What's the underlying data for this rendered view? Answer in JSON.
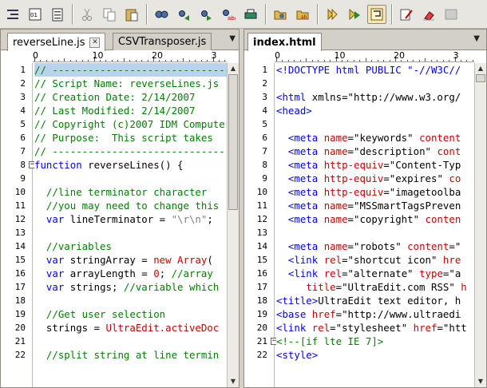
{
  "toolbar": {
    "buttons": [
      {
        "name": "indent-icon"
      },
      {
        "name": "hex-icon"
      },
      {
        "name": "clipboard-list-icon"
      },
      {
        "sep": true
      },
      {
        "name": "cut-icon"
      },
      {
        "name": "copy-icon"
      },
      {
        "name": "paste-icon"
      },
      {
        "sep": true
      },
      {
        "name": "find-icon"
      },
      {
        "name": "find-prev-icon"
      },
      {
        "name": "find-next-icon"
      },
      {
        "name": "replace-icon"
      },
      {
        "name": "print-icon"
      },
      {
        "sep": true
      },
      {
        "name": "folder-search-icon"
      },
      {
        "name": "folder-replace-icon"
      },
      {
        "sep": true
      },
      {
        "name": "macro-icon"
      },
      {
        "name": "play-macro-icon"
      },
      {
        "name": "wrap-icon",
        "active": true
      },
      {
        "sep": true
      },
      {
        "name": "edit-icon"
      },
      {
        "name": "erase-icon"
      },
      {
        "name": "column-icon"
      }
    ]
  },
  "left_pane": {
    "tabs": [
      {
        "label": "reverseLine.js",
        "active": true
      },
      {
        "label": "CSVTransposer.js",
        "active": false
      }
    ],
    "ruler": [
      "0",
      "10",
      "20",
      "3"
    ],
    "lines": [
      {
        "n": "1",
        "fold": false,
        "selected": true,
        "html": "<span class='c-comment'>// ---------------------------------------</span>"
      },
      {
        "n": "2",
        "fold": false,
        "html": "<span class='c-comment'>// Script Name: reverseLines.js</span>"
      },
      {
        "n": "3",
        "fold": false,
        "html": "<span class='c-comment'>// Creation Date: 2/14/2007</span>"
      },
      {
        "n": "4",
        "fold": false,
        "html": "<span class='c-comment'>// Last Modified: 2/14/2007</span>"
      },
      {
        "n": "5",
        "fold": false,
        "html": "<span class='c-comment'>// Copyright (c)2007 IDM Computer</span>"
      },
      {
        "n": "6",
        "fold": false,
        "html": "<span class='c-comment'>// Purpose:  This script takes</span>"
      },
      {
        "n": "7",
        "fold": false,
        "html": "<span class='c-comment'>// ---------------------------------------</span>"
      },
      {
        "n": "8",
        "fold": true,
        "html": "<span class='c-key'>function</span> reverseLines() {"
      },
      {
        "n": "9",
        "fold": false,
        "html": ""
      },
      {
        "n": "10",
        "fold": false,
        "html": "  <span class='c-comment'>//line terminator character</span>"
      },
      {
        "n": "11",
        "fold": false,
        "html": "  <span class='c-comment'>//you may need to change this</span>"
      },
      {
        "n": "12",
        "fold": false,
        "html": "  <span class='c-key'>var</span> lineTerminator = <span class='c-str'>\"\\r\\n\"</span>;"
      },
      {
        "n": "13",
        "fold": false,
        "html": ""
      },
      {
        "n": "14",
        "fold": false,
        "html": "  <span class='c-comment'>//variables</span>"
      },
      {
        "n": "15",
        "fold": false,
        "html": "  <span class='c-key'>var</span> stringArray = <span class='c-red'>new Array</span>("
      },
      {
        "n": "16",
        "fold": false,
        "html": "  <span class='c-key'>var</span> arrayLength = <span class='c-red'>0</span>; <span class='c-comment'>//array</span>"
      },
      {
        "n": "17",
        "fold": false,
        "html": "  <span class='c-key'>var</span> strings; <span class='c-comment'>//variable which</span>"
      },
      {
        "n": "18",
        "fold": false,
        "html": ""
      },
      {
        "n": "19",
        "fold": false,
        "html": "  <span class='c-comment'>//Get user selection</span>"
      },
      {
        "n": "20",
        "fold": false,
        "html": "  strings = <span class='c-red'>UltraEdit.activeDoc</span>"
      },
      {
        "n": "21",
        "fold": false,
        "html": ""
      },
      {
        "n": "22",
        "fold": false,
        "html": "  <span class='c-comment'>//split string at line termin</span>"
      }
    ]
  },
  "right_pane": {
    "tabs": [
      {
        "label": "index.html",
        "active": true
      }
    ],
    "ruler": [
      "0",
      "10",
      "20",
      "3"
    ],
    "lines": [
      {
        "n": "1",
        "fold": false,
        "html": "<span class='c-tag'>&lt;!DOCTYPE html PUBLIC \"-//W3C//</span>"
      },
      {
        "n": "2",
        "fold": false,
        "html": ""
      },
      {
        "n": "3",
        "fold": false,
        "html": "<span class='c-tag'>&lt;html</span> xmlns=\"http://www.w3.org/"
      },
      {
        "n": "4",
        "fold": false,
        "html": "<span class='c-tag'>&lt;head&gt;</span>"
      },
      {
        "n": "5",
        "fold": false,
        "html": ""
      },
      {
        "n": "6",
        "fold": false,
        "html": "  <span class='c-tag'>&lt;meta</span> <span class='c-attr'>name</span>=\"keywords\" <span class='c-attr'>content</span>"
      },
      {
        "n": "7",
        "fold": false,
        "html": "  <span class='c-tag'>&lt;meta</span> <span class='c-attr'>name</span>=\"description\" <span class='c-attr'>cont</span>"
      },
      {
        "n": "8",
        "fold": false,
        "html": "  <span class='c-tag'>&lt;meta</span> <span class='c-attr'>http-equiv</span>=\"Content-Typ"
      },
      {
        "n": "9",
        "fold": false,
        "html": "  <span class='c-tag'>&lt;meta</span> <span class='c-attr'>http-equiv</span>=\"expires\" <span class='c-attr'>co</span>"
      },
      {
        "n": "10",
        "fold": false,
        "html": "  <span class='c-tag'>&lt;meta</span> <span class='c-attr'>http-equiv</span>=\"imagetoolba"
      },
      {
        "n": "11",
        "fold": false,
        "html": "  <span class='c-tag'>&lt;meta</span> <span class='c-attr'>name</span>=\"MSSmartTagsPreven"
      },
      {
        "n": "12",
        "fold": false,
        "html": "  <span class='c-tag'>&lt;meta</span> <span class='c-attr'>name</span>=\"copyright\" <span class='c-attr'>conten</span>"
      },
      {
        "n": "13",
        "fold": false,
        "html": ""
      },
      {
        "n": "14",
        "fold": false,
        "html": "  <span class='c-tag'>&lt;meta</span> <span class='c-attr'>name</span>=\"robots\" <span class='c-attr'>content</span>=\""
      },
      {
        "n": "15",
        "fold": false,
        "html": "  <span class='c-tag'>&lt;link</span> <span class='c-attr'>rel</span>=\"shortcut icon\" <span class='c-attr'>hre</span>"
      },
      {
        "n": "16",
        "fold": false,
        "html": "  <span class='c-tag'>&lt;link</span> <span class='c-attr'>rel</span>=\"alternate\" <span class='c-attr'>type</span>=\"a"
      },
      {
        "n": "17",
        "fold": false,
        "html": "     <span class='c-attr'>title</span>=\"UltraEdit.com RSS\" <span class='c-attr'>h</span>"
      },
      {
        "n": "18",
        "fold": false,
        "html": "<span class='c-tag'>&lt;title&gt;</span>UltraEdit text editor, h"
      },
      {
        "n": "19",
        "fold": false,
        "html": "<span class='c-tag'>&lt;base</span> <span class='c-attr'>href</span>=\"http://www.ultraedi"
      },
      {
        "n": "20",
        "fold": false,
        "html": "<span class='c-tag'>&lt;link</span> <span class='c-attr'>rel</span>=\"stylesheet\" <span class='c-attr'>href</span>=\"htt"
      },
      {
        "n": "21",
        "fold": true,
        "html": "<span class='c-comment'>&lt;!--[if lte IE 7]&gt;</span>"
      },
      {
        "n": "22",
        "fold": false,
        "html": "<span class='c-tag'>&lt;style&gt;</span>"
      }
    ]
  }
}
